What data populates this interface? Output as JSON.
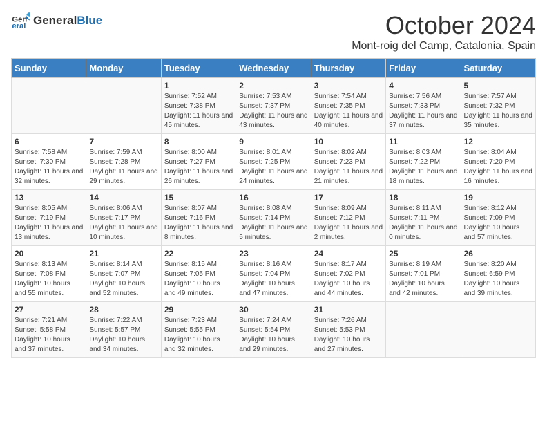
{
  "header": {
    "logo_general": "General",
    "logo_blue": "Blue",
    "month": "October 2024",
    "location": "Mont-roig del Camp, Catalonia, Spain"
  },
  "days_of_week": [
    "Sunday",
    "Monday",
    "Tuesday",
    "Wednesday",
    "Thursday",
    "Friday",
    "Saturday"
  ],
  "weeks": [
    [
      {
        "day": "",
        "sunrise": "",
        "sunset": "",
        "daylight": ""
      },
      {
        "day": "",
        "sunrise": "",
        "sunset": "",
        "daylight": ""
      },
      {
        "day": "1",
        "sunrise": "Sunrise: 7:52 AM",
        "sunset": "Sunset: 7:38 PM",
        "daylight": "Daylight: 11 hours and 45 minutes."
      },
      {
        "day": "2",
        "sunrise": "Sunrise: 7:53 AM",
        "sunset": "Sunset: 7:37 PM",
        "daylight": "Daylight: 11 hours and 43 minutes."
      },
      {
        "day": "3",
        "sunrise": "Sunrise: 7:54 AM",
        "sunset": "Sunset: 7:35 PM",
        "daylight": "Daylight: 11 hours and 40 minutes."
      },
      {
        "day": "4",
        "sunrise": "Sunrise: 7:56 AM",
        "sunset": "Sunset: 7:33 PM",
        "daylight": "Daylight: 11 hours and 37 minutes."
      },
      {
        "day": "5",
        "sunrise": "Sunrise: 7:57 AM",
        "sunset": "Sunset: 7:32 PM",
        "daylight": "Daylight: 11 hours and 35 minutes."
      }
    ],
    [
      {
        "day": "6",
        "sunrise": "Sunrise: 7:58 AM",
        "sunset": "Sunset: 7:30 PM",
        "daylight": "Daylight: 11 hours and 32 minutes."
      },
      {
        "day": "7",
        "sunrise": "Sunrise: 7:59 AM",
        "sunset": "Sunset: 7:28 PM",
        "daylight": "Daylight: 11 hours and 29 minutes."
      },
      {
        "day": "8",
        "sunrise": "Sunrise: 8:00 AM",
        "sunset": "Sunset: 7:27 PM",
        "daylight": "Daylight: 11 hours and 26 minutes."
      },
      {
        "day": "9",
        "sunrise": "Sunrise: 8:01 AM",
        "sunset": "Sunset: 7:25 PM",
        "daylight": "Daylight: 11 hours and 24 minutes."
      },
      {
        "day": "10",
        "sunrise": "Sunrise: 8:02 AM",
        "sunset": "Sunset: 7:23 PM",
        "daylight": "Daylight: 11 hours and 21 minutes."
      },
      {
        "day": "11",
        "sunrise": "Sunrise: 8:03 AM",
        "sunset": "Sunset: 7:22 PM",
        "daylight": "Daylight: 11 hours and 18 minutes."
      },
      {
        "day": "12",
        "sunrise": "Sunrise: 8:04 AM",
        "sunset": "Sunset: 7:20 PM",
        "daylight": "Daylight: 11 hours and 16 minutes."
      }
    ],
    [
      {
        "day": "13",
        "sunrise": "Sunrise: 8:05 AM",
        "sunset": "Sunset: 7:19 PM",
        "daylight": "Daylight: 11 hours and 13 minutes."
      },
      {
        "day": "14",
        "sunrise": "Sunrise: 8:06 AM",
        "sunset": "Sunset: 7:17 PM",
        "daylight": "Daylight: 11 hours and 10 minutes."
      },
      {
        "day": "15",
        "sunrise": "Sunrise: 8:07 AM",
        "sunset": "Sunset: 7:16 PM",
        "daylight": "Daylight: 11 hours and 8 minutes."
      },
      {
        "day": "16",
        "sunrise": "Sunrise: 8:08 AM",
        "sunset": "Sunset: 7:14 PM",
        "daylight": "Daylight: 11 hours and 5 minutes."
      },
      {
        "day": "17",
        "sunrise": "Sunrise: 8:09 AM",
        "sunset": "Sunset: 7:12 PM",
        "daylight": "Daylight: 11 hours and 2 minutes."
      },
      {
        "day": "18",
        "sunrise": "Sunrise: 8:11 AM",
        "sunset": "Sunset: 7:11 PM",
        "daylight": "Daylight: 11 hours and 0 minutes."
      },
      {
        "day": "19",
        "sunrise": "Sunrise: 8:12 AM",
        "sunset": "Sunset: 7:09 PM",
        "daylight": "Daylight: 10 hours and 57 minutes."
      }
    ],
    [
      {
        "day": "20",
        "sunrise": "Sunrise: 8:13 AM",
        "sunset": "Sunset: 7:08 PM",
        "daylight": "Daylight: 10 hours and 55 minutes."
      },
      {
        "day": "21",
        "sunrise": "Sunrise: 8:14 AM",
        "sunset": "Sunset: 7:07 PM",
        "daylight": "Daylight: 10 hours and 52 minutes."
      },
      {
        "day": "22",
        "sunrise": "Sunrise: 8:15 AM",
        "sunset": "Sunset: 7:05 PM",
        "daylight": "Daylight: 10 hours and 49 minutes."
      },
      {
        "day": "23",
        "sunrise": "Sunrise: 8:16 AM",
        "sunset": "Sunset: 7:04 PM",
        "daylight": "Daylight: 10 hours and 47 minutes."
      },
      {
        "day": "24",
        "sunrise": "Sunrise: 8:17 AM",
        "sunset": "Sunset: 7:02 PM",
        "daylight": "Daylight: 10 hours and 44 minutes."
      },
      {
        "day": "25",
        "sunrise": "Sunrise: 8:19 AM",
        "sunset": "Sunset: 7:01 PM",
        "daylight": "Daylight: 10 hours and 42 minutes."
      },
      {
        "day": "26",
        "sunrise": "Sunrise: 8:20 AM",
        "sunset": "Sunset: 6:59 PM",
        "daylight": "Daylight: 10 hours and 39 minutes."
      }
    ],
    [
      {
        "day": "27",
        "sunrise": "Sunrise: 7:21 AM",
        "sunset": "Sunset: 5:58 PM",
        "daylight": "Daylight: 10 hours and 37 minutes."
      },
      {
        "day": "28",
        "sunrise": "Sunrise: 7:22 AM",
        "sunset": "Sunset: 5:57 PM",
        "daylight": "Daylight: 10 hours and 34 minutes."
      },
      {
        "day": "29",
        "sunrise": "Sunrise: 7:23 AM",
        "sunset": "Sunset: 5:55 PM",
        "daylight": "Daylight: 10 hours and 32 minutes."
      },
      {
        "day": "30",
        "sunrise": "Sunrise: 7:24 AM",
        "sunset": "Sunset: 5:54 PM",
        "daylight": "Daylight: 10 hours and 29 minutes."
      },
      {
        "day": "31",
        "sunrise": "Sunrise: 7:26 AM",
        "sunset": "Sunset: 5:53 PM",
        "daylight": "Daylight: 10 hours and 27 minutes."
      },
      {
        "day": "",
        "sunrise": "",
        "sunset": "",
        "daylight": ""
      },
      {
        "day": "",
        "sunrise": "",
        "sunset": "",
        "daylight": ""
      }
    ]
  ]
}
